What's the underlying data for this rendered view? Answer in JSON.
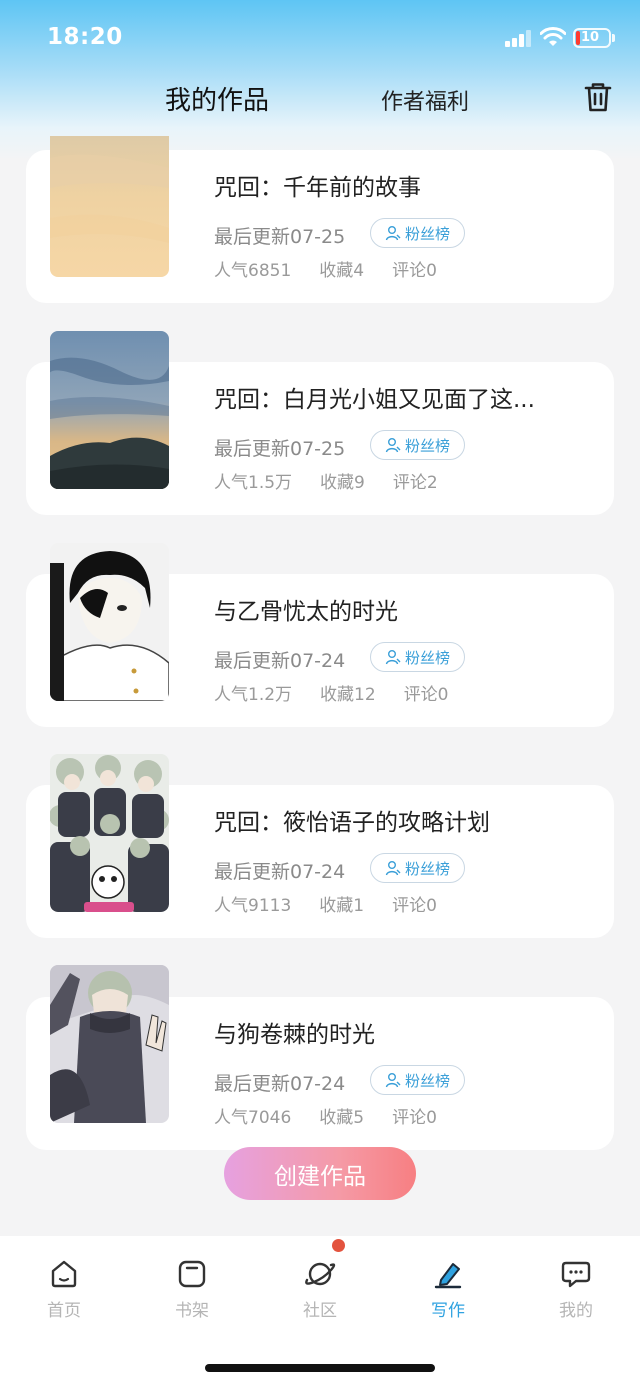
{
  "status_bar": {
    "time": "18:20",
    "battery": "10"
  },
  "header": {
    "tab_my_works": "我的作品",
    "tab_author_benefits": "作者福利"
  },
  "works": [
    {
      "title": "咒回：千年前的故事",
      "updated": "最后更新07-25",
      "badge": "粉丝榜",
      "popularity": "人气6851",
      "favorites": "收藏4",
      "comments": "评论0"
    },
    {
      "title": "咒回：白月光小姐又见面了这...",
      "updated": "最后更新07-25",
      "badge": "粉丝榜",
      "popularity": "人气1.5万",
      "favorites": "收藏9",
      "comments": "评论2"
    },
    {
      "title": "与乙骨忧太的时光",
      "updated": "最后更新07-24",
      "badge": "粉丝榜",
      "popularity": "人气1.2万",
      "favorites": "收藏12",
      "comments": "评论0"
    },
    {
      "title": "咒回：筱怡语子的攻略计划",
      "updated": "最后更新07-24",
      "badge": "粉丝榜",
      "popularity": "人气9113",
      "favorites": "收藏1",
      "comments": "评论0"
    },
    {
      "title": "与狗卷棘的时光",
      "updated": "最后更新07-24",
      "badge": "粉丝榜",
      "popularity": "人气7046",
      "favorites": "收藏5",
      "comments": "评论0"
    }
  ],
  "create_button": "创建作品",
  "nav": [
    {
      "label": "首页",
      "icon": "home-icon"
    },
    {
      "label": "书架",
      "icon": "bookshelf-icon"
    },
    {
      "label": "社区",
      "icon": "planet-icon"
    },
    {
      "label": "写作",
      "icon": "pen-icon",
      "active": true
    },
    {
      "label": "我的",
      "icon": "chat-bubble-icon"
    }
  ],
  "colors": {
    "accent": "#2fa2e0",
    "badge_dot": "#e3533e"
  }
}
